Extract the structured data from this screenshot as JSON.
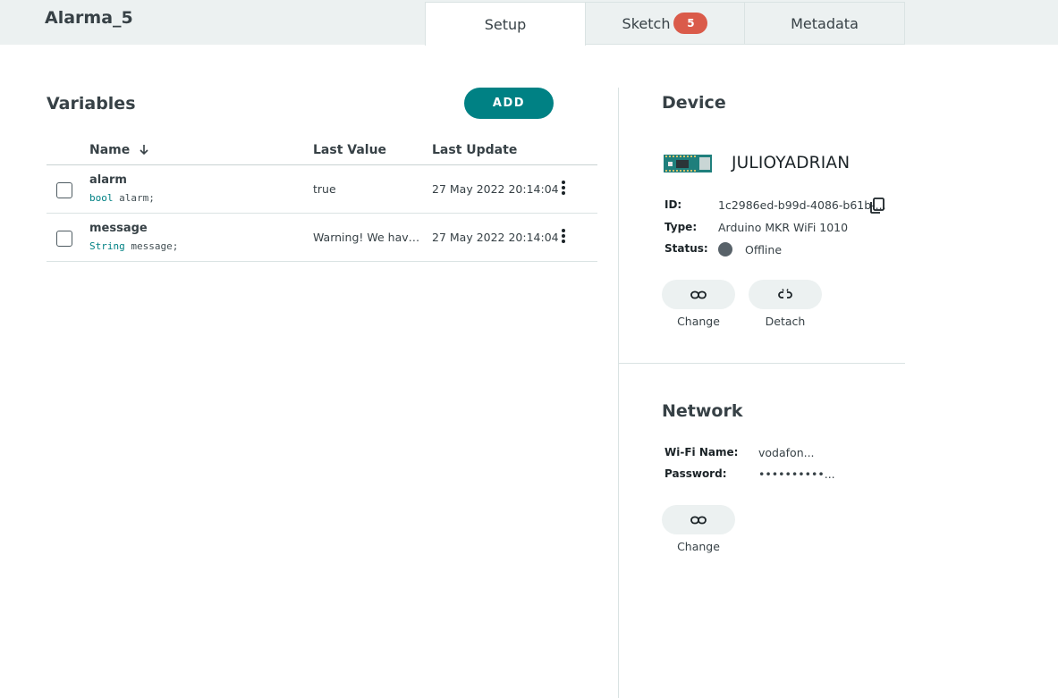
{
  "header": {
    "title": "Alarma_5",
    "tabs": [
      {
        "label": "Setup",
        "active": true
      },
      {
        "label": "Sketch",
        "badge": "5"
      },
      {
        "label": "Metadata"
      }
    ]
  },
  "variables": {
    "title": "Variables",
    "add_label": "ADD",
    "columns": [
      "Name",
      "Last Value",
      "Last Update"
    ],
    "sort_icon": "arrow-down-icon",
    "rows": [
      {
        "name": "alarm",
        "type": "bool",
        "decl": "alarm;",
        "value": "true",
        "updated": "27 May 2022 20:14:04"
      },
      {
        "name": "message",
        "type": "String",
        "decl": "message;",
        "value": "Warning! We have detected",
        "updated": "27 May 2022 20:14:04"
      }
    ]
  },
  "device": {
    "title": "Device",
    "name": "JULIOYADRIAN",
    "id_label": "ID:",
    "id_value": "1c2986ed-b99d-4086-b61b-...",
    "type_label": "Type:",
    "type_value": "Arduino MKR WiFi 1010",
    "status_label": "Status:",
    "status_value": "Offline",
    "change_label": "Change",
    "detach_label": "Detach"
  },
  "network": {
    "title": "Network",
    "wifi_label": "Wi-Fi Name:",
    "wifi_value": "vodafon...",
    "password_label": "Password:",
    "password_value": "••••••••••...",
    "change_label": "Change"
  },
  "colors": {
    "accent": "#008184",
    "badge": "#da5b4a",
    "topbar": "#ecf1f1",
    "status_offline": "#586269"
  }
}
